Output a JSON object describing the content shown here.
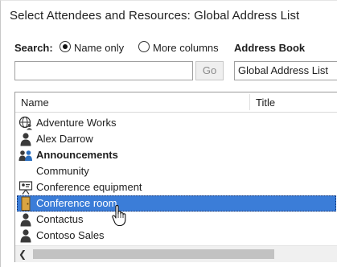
{
  "dialog": {
    "title": "Select Attendees and Resources: Global Address List"
  },
  "search": {
    "label": "Search:",
    "options": [
      {
        "label": "Name only",
        "checked": true
      },
      {
        "label": "More columns",
        "checked": false
      }
    ],
    "input_value": "",
    "go_label": "Go"
  },
  "address_book": {
    "label": "Address Book",
    "selected": "Global Address List"
  },
  "list": {
    "columns": [
      "Name",
      "Title"
    ],
    "rows": [
      {
        "name": "Adventure Works",
        "icon": "globe-contact-icon",
        "bold": false,
        "selected": false
      },
      {
        "name": "Alex Darrow",
        "icon": "person-icon",
        "bold": false,
        "selected": false
      },
      {
        "name": "Announcements",
        "icon": "group-icon",
        "bold": true,
        "selected": false
      },
      {
        "name": "Community",
        "icon": "",
        "bold": false,
        "selected": false
      },
      {
        "name": "Conference equipment",
        "icon": "equipment-icon",
        "bold": false,
        "selected": false
      },
      {
        "name": "Conference room",
        "icon": "room-icon",
        "bold": false,
        "selected": true
      },
      {
        "name": "Contactus",
        "icon": "person-icon",
        "bold": false,
        "selected": false
      },
      {
        "name": "Contoso Sales",
        "icon": "person-icon",
        "bold": false,
        "selected": false
      }
    ]
  },
  "colors": {
    "selection": "#3b7dd8",
    "text": "#1e1e1e"
  }
}
